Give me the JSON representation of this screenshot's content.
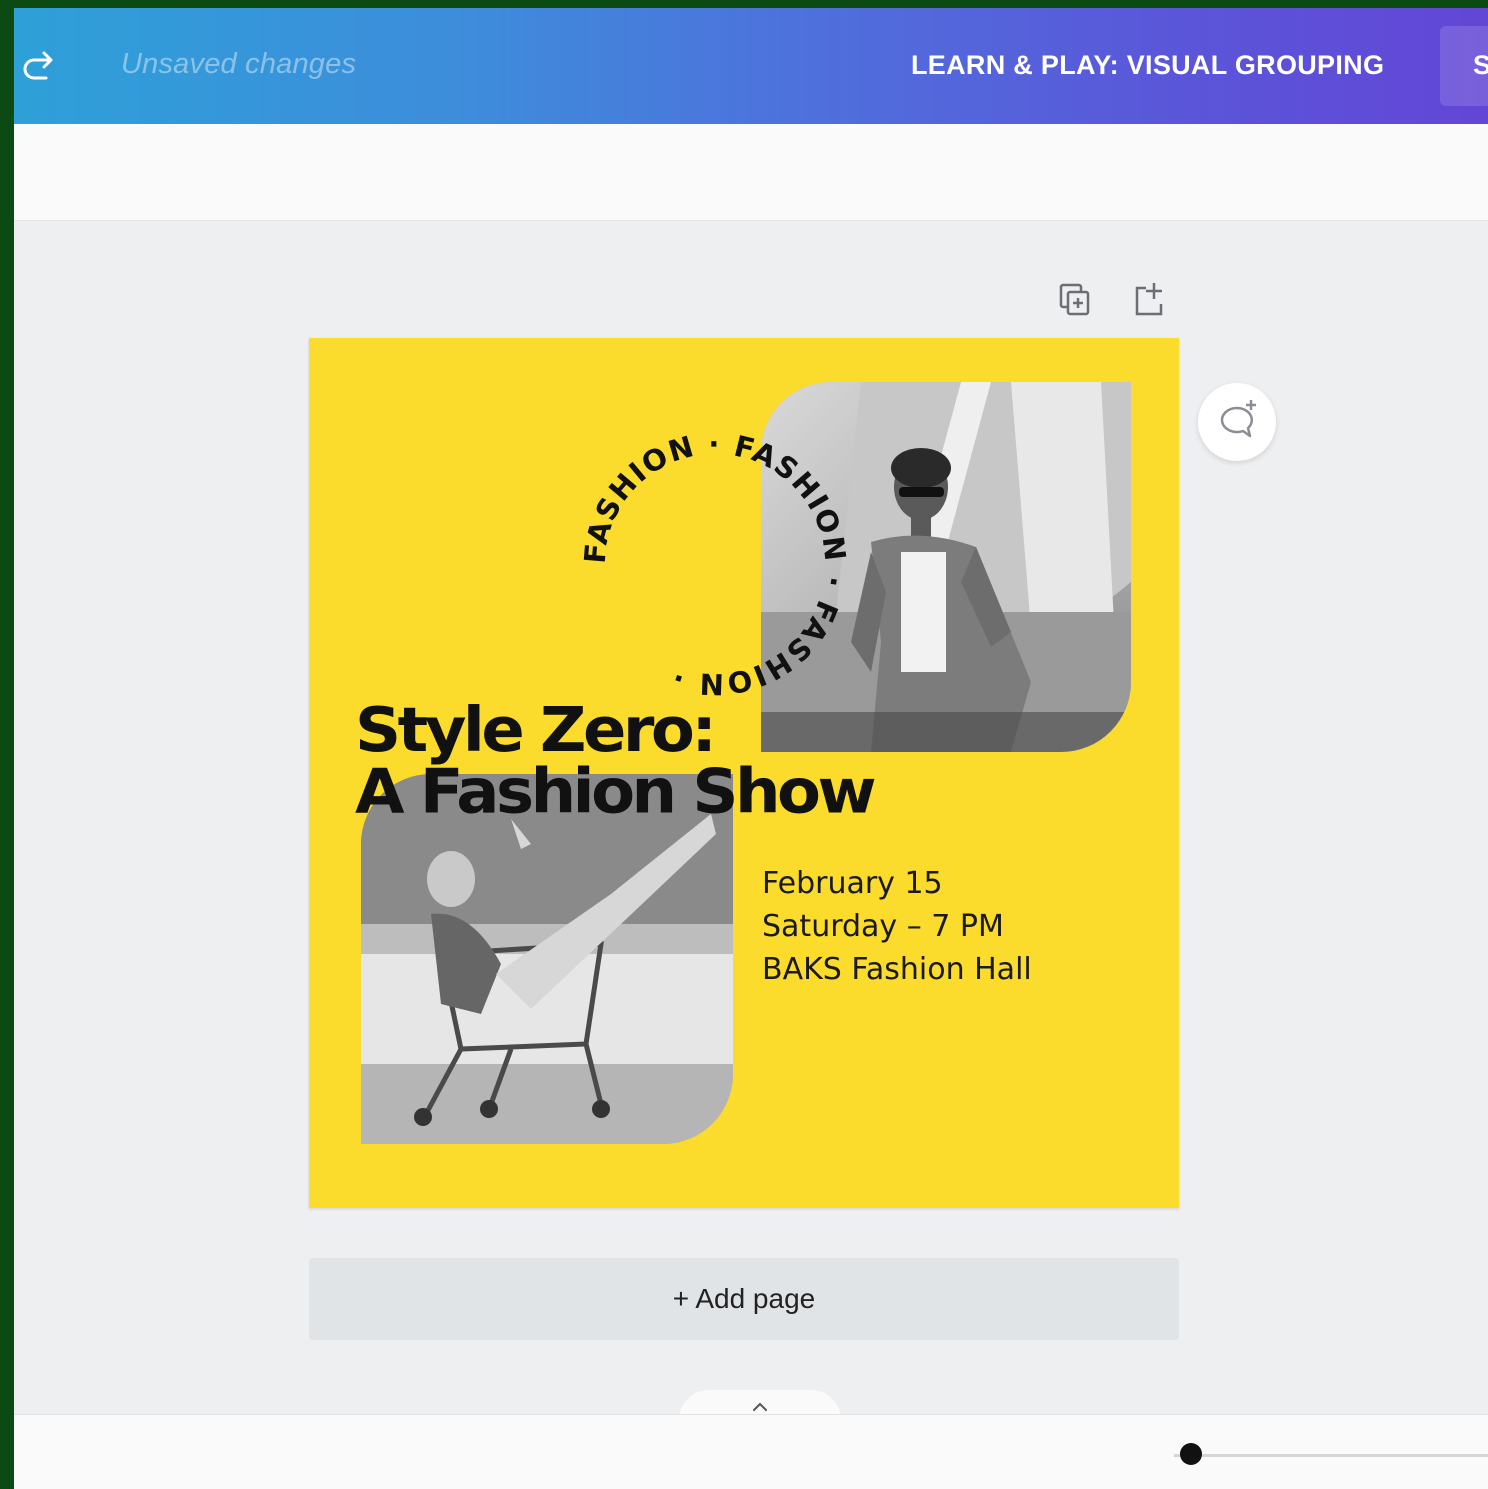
{
  "topbar": {
    "status": "Unsaved changes",
    "project_title": "LEARN & PLAY: VISUAL GROUPING",
    "share_label": "S"
  },
  "design": {
    "background_color": "#fbdb2b",
    "circle_text": "FASHION · FASHION · FASHION · ",
    "headline_line1": "Style Zero:",
    "headline_line2": "A Fashion Show",
    "date": "February 15",
    "time": "Saturday – 7 PM",
    "venue": "BAKS Fashion Hall"
  },
  "canvas": {
    "add_page_label": "+ Add page"
  },
  "icons": [
    "redo-icon",
    "duplicate-page-icon",
    "add-page-icon",
    "add-comment-icon",
    "chevron-up-icon"
  ],
  "colors": {
    "accent_gradient_start": "#2ea0d8",
    "accent_gradient_end": "#6246d6",
    "canvas_background": "#eeeff1"
  }
}
